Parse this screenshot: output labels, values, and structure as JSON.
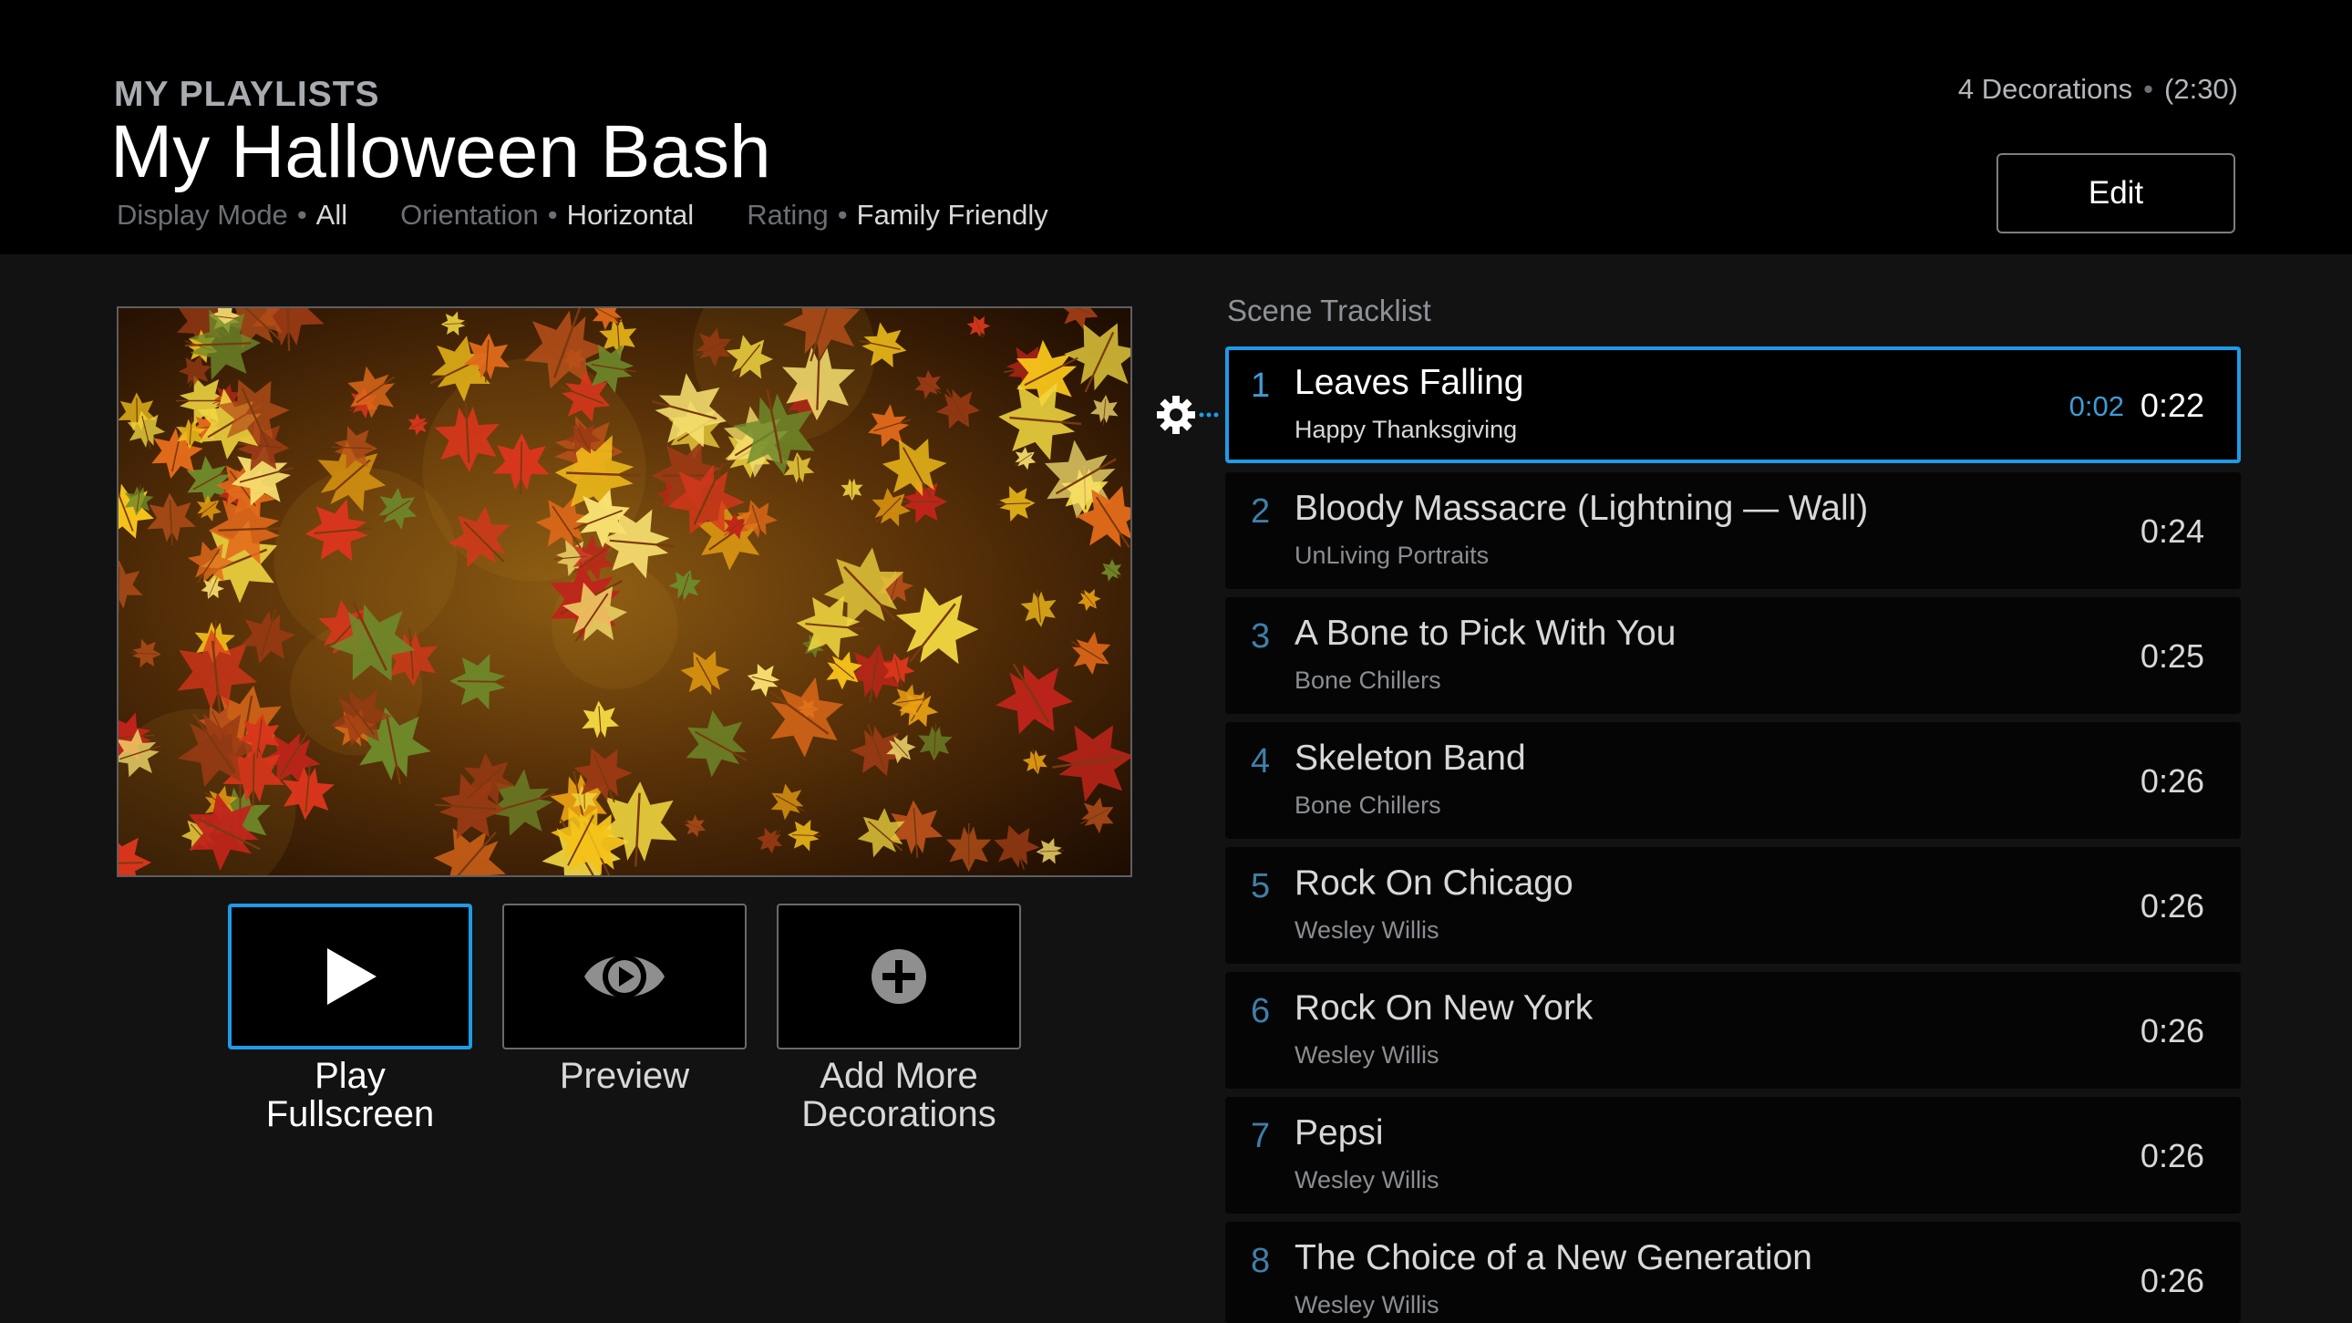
{
  "header": {
    "section": "MY PLAYLISTS",
    "title": "My Halloween Bash",
    "meta": [
      {
        "label": "Display Mode",
        "value": "All"
      },
      {
        "label": "Orientation",
        "value": "Horizontal"
      },
      {
        "label": "Rating",
        "value": "Family Friendly"
      }
    ],
    "meta_separator": "•",
    "decorations_count": "4 Decorations",
    "summary_separator": "•",
    "total_duration": "(2:30)",
    "edit_label": "Edit"
  },
  "actions": {
    "play": {
      "line1": "Play",
      "line2": "Fullscreen"
    },
    "preview": {
      "line1": "Preview"
    },
    "add": {
      "line1": "Add More",
      "line2": "Decorations"
    }
  },
  "tracklist": {
    "title": "Scene Tracklist",
    "tracks": [
      {
        "num": "1",
        "title": "Leaves Falling",
        "subtitle": "Happy Thanksgiving",
        "elapsed": "0:02",
        "duration": "0:22"
      },
      {
        "num": "2",
        "title": "Bloody Massacre (Lightning — Wall)",
        "subtitle": "UnLiving Portraits",
        "duration": "0:24"
      },
      {
        "num": "3",
        "title": "A Bone to Pick With You",
        "subtitle": "Bone Chillers",
        "duration": "0:25"
      },
      {
        "num": "4",
        "title": "Skeleton Band",
        "subtitle": "Bone Chillers",
        "duration": "0:26"
      },
      {
        "num": "5",
        "title": "Rock On Chicago",
        "subtitle": "Wesley Willis",
        "duration": "0:26"
      },
      {
        "num": "6",
        "title": "Rock On New York",
        "subtitle": "Wesley Willis",
        "duration": "0:26"
      },
      {
        "num": "7",
        "title": "Pepsi",
        "subtitle": "Wesley Willis",
        "duration": "0:26"
      },
      {
        "num": "8",
        "title": "The Choice of a New Generation",
        "subtitle": "Wesley Willis",
        "duration": "0:26"
      }
    ]
  },
  "colors": {
    "accent": "#1e9be6",
    "background": "#121212",
    "header_background": "#000000"
  },
  "icons": {
    "play": "play-icon",
    "preview": "eye-play-icon",
    "add": "plus-circle-icon",
    "settings": "gear-icon"
  }
}
